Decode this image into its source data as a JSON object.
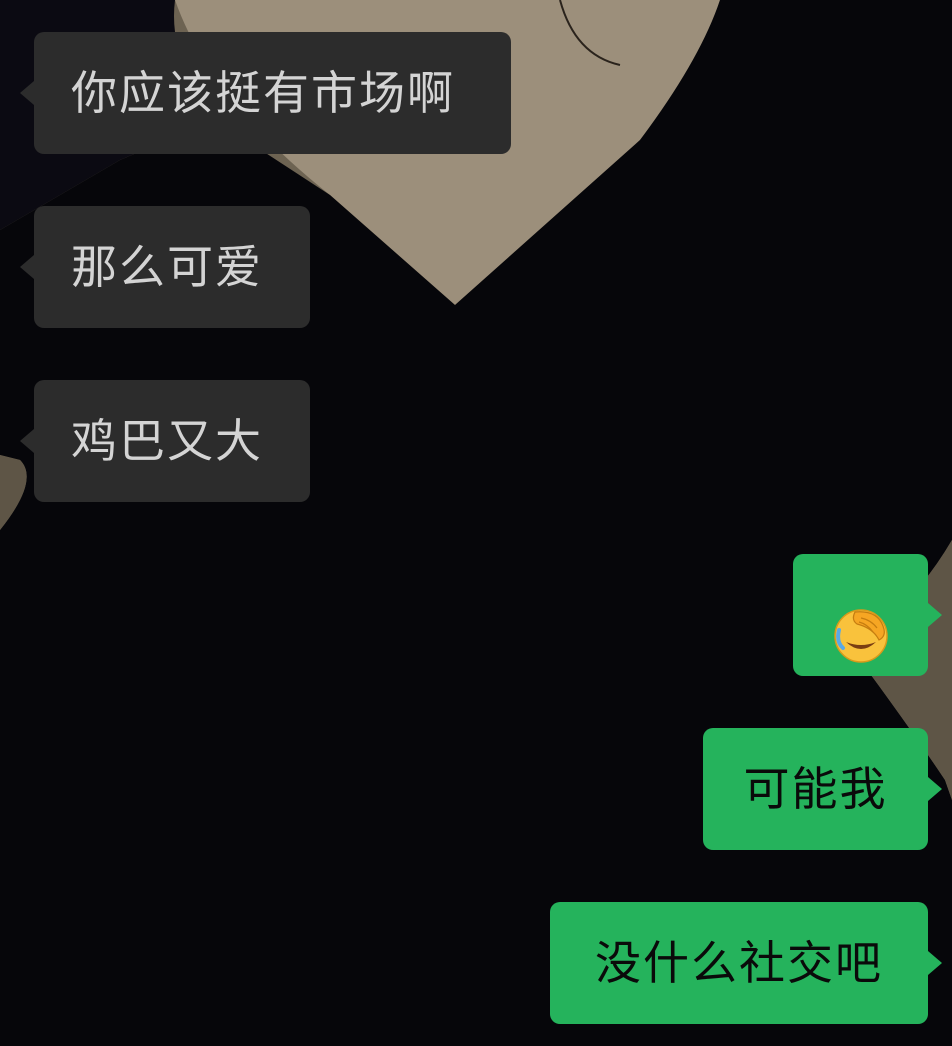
{
  "chat": {
    "messages": [
      {
        "direction": "received",
        "text": "你应该挺有市场啊"
      },
      {
        "direction": "received",
        "text": "那么可爱"
      },
      {
        "direction": "received",
        "text": "鸡巴又大"
      },
      {
        "direction": "sent",
        "emoji": "face-palm-tears-emoji"
      },
      {
        "direction": "sent",
        "text": "可能我"
      },
      {
        "direction": "sent",
        "text": "没什么社交吧"
      }
    ]
  },
  "colors": {
    "received_bubble": "#2c2c2c",
    "received_text": "#d4d4d4",
    "sent_bubble": "#25b35c",
    "sent_text": "#0a0a0a"
  }
}
